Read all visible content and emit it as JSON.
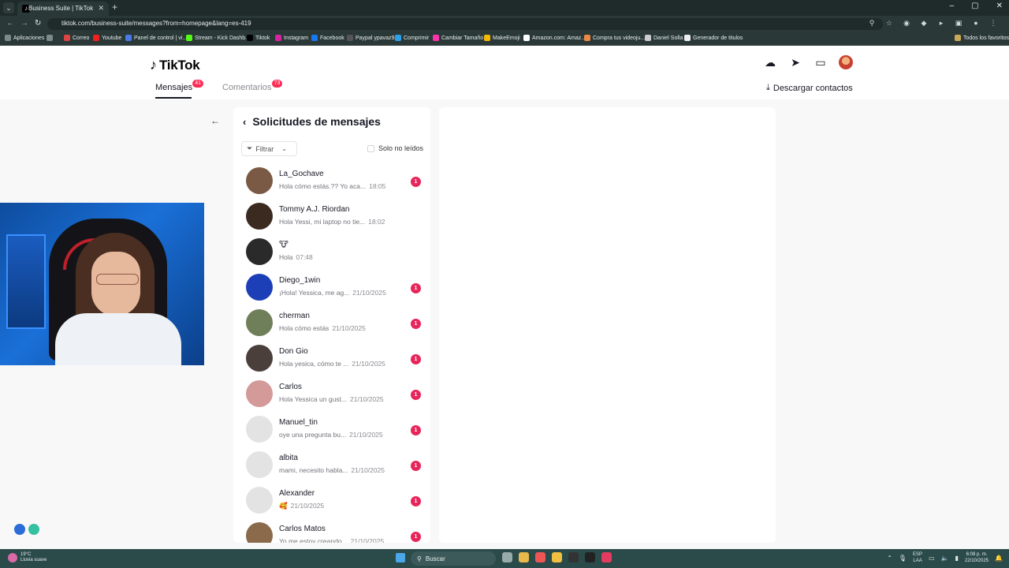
{
  "browser": {
    "tab_title": "Business Suite | TikTok",
    "url": "tiktok.com/business-suite/messages?from=homepage&lang=es-419",
    "bookmarks": [
      "Aplicaciones",
      "Correo",
      "Youtube",
      "Panel de control | vi...",
      "Stream - Kick Dashb...",
      "Tiktok",
      "Instagram",
      "Facebook",
      "Paypal ypavaz92",
      "Comprimir",
      "Cambiar Tamaño",
      "MakeEmoji",
      "Amazon.com: Amaz...",
      "Compra tus videoju...",
      "Daniel Solla",
      "Generador de titulos"
    ],
    "all_favorites": "Todos los favoritos"
  },
  "header": {
    "logo": "TikTok",
    "tab_messages": "Mensajes",
    "tab_messages_count": "41",
    "tab_comments": "Comentarios",
    "tab_comments_count": "73",
    "download_contacts": "Descargar contactos",
    "icons": [
      "upload-icon",
      "send-icon",
      "comment-icon"
    ]
  },
  "requests": {
    "title": "Solicitudes de mensajes",
    "filter_label": "Filtrar",
    "unread_only_label": "Solo no leídos",
    "items": [
      {
        "name": "La_Gochave",
        "preview": "Hola cómo estás.?? Yo aca...",
        "time": "18:05",
        "unread": "1",
        "avatar": "#7a5a44"
      },
      {
        "name": "Tommy A.J. Riordan",
        "preview": "Hola Yessi, mi laptop no tie...",
        "time": "18:02",
        "unread": "",
        "avatar": "#3a2a20"
      },
      {
        "name": "🐮",
        "preview": "Hola",
        "time": "07:48",
        "unread": "",
        "avatar": "#2a2a2a"
      },
      {
        "name": "Diego_1win",
        "preview": "¡Hola! Yessica, me ag...",
        "time": "21/10/2025",
        "unread": "1",
        "avatar": "#1c3fb8"
      },
      {
        "name": "cherman",
        "preview": "Hola cómo estás",
        "time": "21/10/2025",
        "unread": "1",
        "avatar": "#6f7f5a"
      },
      {
        "name": "Don Gio",
        "preview": "Hola yesica, cómo te ...",
        "time": "21/10/2025",
        "unread": "1",
        "avatar": "#4a3f3a"
      },
      {
        "name": "Carlos",
        "preview": "Hola Yessica un gust...",
        "time": "21/10/2025",
        "unread": "1",
        "avatar": "#d49a9a"
      },
      {
        "name": "Manuel_tin",
        "preview": "oye una pregunta bu...",
        "time": "21/10/2025",
        "unread": "1",
        "avatar": "#e3e3e4"
      },
      {
        "name": "albita",
        "preview": "mami, necesito habla...",
        "time": "21/10/2025",
        "unread": "1",
        "avatar": "#e3e3e4"
      },
      {
        "name": "Alexander",
        "preview": "🥰",
        "time": "21/10/2025",
        "unread": "1",
        "avatar": "#e3e3e4"
      },
      {
        "name": "Carlos Matos",
        "preview": "Yo me estoy creando...",
        "time": "21/10/2025",
        "unread": "1",
        "avatar": "#8a6a4a"
      }
    ]
  },
  "taskbar": {
    "temp": "19°C",
    "weather": "Lluvia suave",
    "search_placeholder": "Buscar",
    "lang_line1": "ESP",
    "lang_line2": "LAA",
    "time": "6:08 p. m.",
    "date": "22/10/2025"
  },
  "colors": {
    "accent": "#fe2c55",
    "badge": "#e8255a",
    "browser_dark": "#2b3838",
    "taskbar": "#2b4a4a"
  }
}
